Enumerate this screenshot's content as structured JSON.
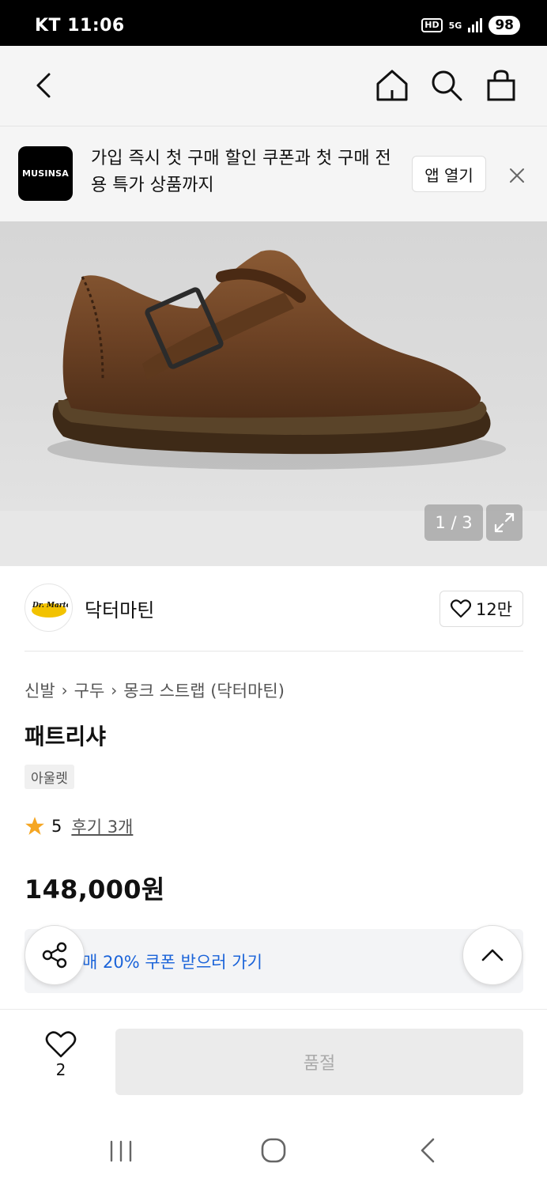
{
  "status_bar": {
    "carrier_time": "KT 11:06",
    "hd": "HD",
    "network": "5G",
    "battery": "98"
  },
  "top_nav": {
    "icons": [
      "back-icon",
      "home-icon",
      "search-icon",
      "shopping-bag-icon"
    ]
  },
  "app_banner": {
    "logo_text": "MUSINSA",
    "message": "가입 즉시 첫 구매 할인 쿠폰과 첫 구매 전용 특가 상품까지",
    "open_label": "앱 열기",
    "close_icon": "close-icon"
  },
  "gallery": {
    "counter": "1 / 3",
    "expand_icon": "expand-icon"
  },
  "brand": {
    "name": "닥터마틴",
    "logo_text": "Dr. Martens",
    "like_count": "12만"
  },
  "product": {
    "breadcrumb": [
      "신발",
      "구두",
      "몽크 스트랩 (닥터마틴)"
    ],
    "title": "패트리샤",
    "tag": "아울렛",
    "rating": "5",
    "reviews": "후기 3개",
    "price": "148,000원",
    "coupon_text": "매 20% 쿠폰 받으러 가기"
  },
  "bottom_bar": {
    "wish_count": "2",
    "buy_label": "품절"
  },
  "colors": {
    "accent_blue": "#1a63d9",
    "star": "#f5a623",
    "soldout_bg": "#ebebeb"
  }
}
